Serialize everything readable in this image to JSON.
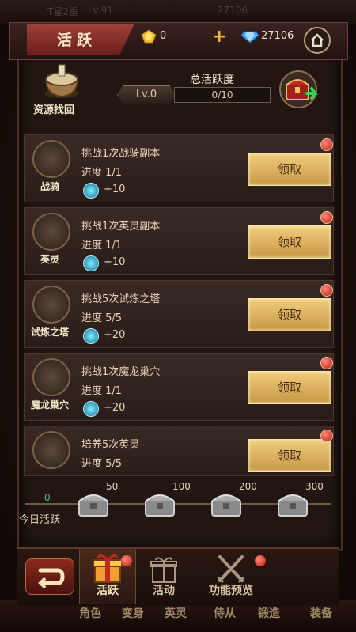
{
  "ghost_top": {
    "text1": "T星2重",
    "level": "Lv.91",
    "value": "27106"
  },
  "titlebar": {
    "tab": "活跃",
    "gold": "0",
    "diamond": "27106"
  },
  "header": {
    "recover_label": "资源找回",
    "total_title": "总活跃度",
    "level": "Lv.0",
    "progress": "0/10"
  },
  "tasks": [
    {
      "icon_label": "战骑",
      "title": "挑战1次战骑副本",
      "progress": "进度 1/1",
      "reward": "+10",
      "button": "领取"
    },
    {
      "icon_label": "英灵",
      "title": "挑战1次英灵副本",
      "progress": "进度 1/1",
      "reward": "+10",
      "button": "领取"
    },
    {
      "icon_label": "试炼之塔",
      "title": "挑战5次试炼之塔",
      "progress": "进度 5/5",
      "reward": "+20",
      "button": "领取"
    },
    {
      "icon_label": "魔龙巢穴",
      "title": "挑战1次魔龙巢穴",
      "progress": "进度 1/1",
      "reward": "+20",
      "button": "领取"
    },
    {
      "icon_label": "",
      "title": "培养5次英灵",
      "progress": "进度 5/5",
      "reward": "",
      "button": "领取"
    }
  ],
  "milestones": {
    "current": "0",
    "label": "今日活跃",
    "values": [
      "50",
      "100",
      "200",
      "300"
    ]
  },
  "tabs": [
    {
      "label": "活跃",
      "active": true
    },
    {
      "label": "活动",
      "active": false
    },
    {
      "label": "功能预览",
      "active": false
    }
  ],
  "bottom_ghost": [
    "角色",
    "变身",
    "英灵",
    "侍从",
    "锻造",
    "装备"
  ],
  "colors": {
    "accent_gold": "#f0cc7c",
    "tab_red": "#a0403a",
    "notify_red": "#c01a10",
    "progress_green": "#3bcf5a"
  }
}
